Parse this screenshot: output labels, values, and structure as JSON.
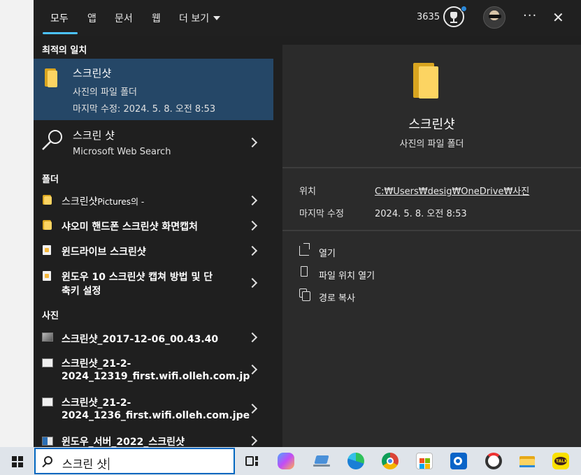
{
  "tabs": [
    {
      "label": "모두",
      "active": true
    },
    {
      "label": "앱"
    },
    {
      "label": "문서"
    },
    {
      "label": "웹"
    },
    {
      "label": "더 보기"
    }
  ],
  "header": {
    "points": "3635",
    "more_icon": "ellipsis-icon",
    "close_icon": "close-icon"
  },
  "best_match": {
    "section": "최적의 일치",
    "title": "스크린샷",
    "subtitle": "사진의 파일 폴더",
    "modified": "마지막 수정: 2024. 5. 8. 오전 8:53"
  },
  "web_search": {
    "title": "스크린 샷",
    "subtitle": "Microsoft Web Search"
  },
  "folders": {
    "section": "폴더",
    "items": [
      {
        "name": "스크린샷",
        "suffix": "Pictures의 -"
      },
      {
        "name": "샤오미 핸드폰 스크린샷 화면캡처"
      },
      {
        "name": "윈드라이브 스크린샷"
      },
      {
        "name": "윈도우 10 스크린샷 캡쳐 방법 및 단",
        "line2": "축키 설정"
      }
    ]
  },
  "photos": {
    "section": "사진",
    "items": [
      {
        "name": "스크린샷_2017-12-06_00.43.40"
      },
      {
        "name": "스크린샷_21-2-",
        "line2": "2024_12319_first.wifi.olleh.com.jp"
      },
      {
        "name": "스크린샷_21-2-",
        "line2": "2024_1236_first.wifi.olleh.com.jpe"
      },
      {
        "name": "윈도우_서버_2022_스크린샷"
      }
    ]
  },
  "detail": {
    "title": "스크린샷",
    "subtitle": "사진의 파일 폴더",
    "location_label": "위치",
    "location_value": "C:₩Users₩desig₩OneDrive₩사진",
    "modified_label": "마지막 수정",
    "modified_value": "2024. 5. 8. 오전 8:53",
    "actions": [
      "열기",
      "파일 위치 열기",
      "경로 복사"
    ]
  },
  "taskbar": {
    "search_query": "스크린 샷",
    "icons": [
      "task-view-icon",
      "copilot-icon",
      "laptop-icon",
      "edge-icon",
      "chrome-icon",
      "store-icon",
      "outlook-icon",
      "capture-icon",
      "file-explorer-icon",
      "kakaotalk-icon"
    ],
    "kakao_label": "TALK"
  },
  "colors": {
    "accent": "#4cc2ff",
    "selected": "#254767",
    "folder": "#fcd462"
  }
}
